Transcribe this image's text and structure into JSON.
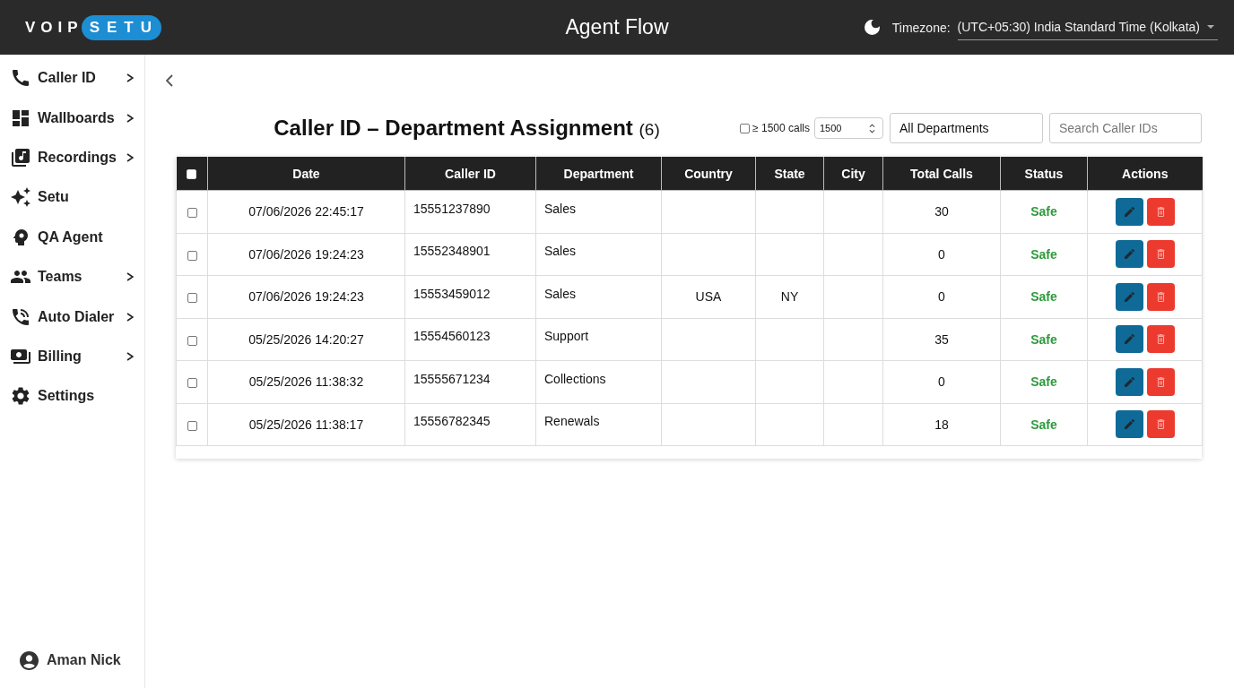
{
  "header": {
    "logo": {
      "plain": "VOIP",
      "highlighted": "SETU"
    },
    "title": "Agent Flow",
    "timezone": {
      "label": "Timezone:",
      "value": "(UTC+05:30) India Standard Time (Kolkata)"
    }
  },
  "sidebar": {
    "items": [
      {
        "label": "Caller ID",
        "has_submenu": true
      },
      {
        "label": "Wallboards",
        "has_submenu": true
      },
      {
        "label": "Recordings",
        "has_submenu": true
      },
      {
        "label": "Setu",
        "has_submenu": false
      },
      {
        "label": "QA Agent",
        "has_submenu": false
      },
      {
        "label": "Teams",
        "has_submenu": true
      },
      {
        "label": "Auto Dialer",
        "has_submenu": true
      },
      {
        "label": "Billing",
        "has_submenu": true
      },
      {
        "label": "Settings",
        "has_submenu": false
      }
    ],
    "user": {
      "name": "Aman Nick"
    }
  },
  "page": {
    "title": "Caller ID – Department Assignment",
    "count": "(6)",
    "filters": {
      "min_calls": {
        "checked": false,
        "label": "≥ 1500 calls",
        "value": "1500"
      },
      "department": {
        "value": "All Departments"
      },
      "search": {
        "placeholder": "Search Caller IDs"
      }
    }
  },
  "table": {
    "select_all": {
      "checked": false
    },
    "columns": [
      "Date",
      "Caller ID",
      "Department",
      "Country",
      "State",
      "City",
      "Total Calls",
      "Status",
      "Actions"
    ],
    "rows": [
      {
        "selected": false,
        "date": "07/06/2026 22:45:17",
        "caller_id": "15551237890",
        "department": "Sales",
        "total_calls": "30",
        "status": "Safe"
      },
      {
        "selected": false,
        "date": "07/06/2026 19:24:23",
        "caller_id": "15552348901",
        "department": "Sales",
        "total_calls": "0",
        "status": "Safe"
      },
      {
        "selected": false,
        "date": "07/06/2026 19:24:23",
        "caller_id": "15553459012",
        "department": "Sales",
        "country": "USA",
        "state": "NY",
        "total_calls": "0",
        "status": "Safe"
      },
      {
        "selected": false,
        "date": "05/25/2026 14:20:27",
        "caller_id": "15554560123",
        "department": "Support",
        "total_calls": "35",
        "status": "Safe"
      },
      {
        "selected": false,
        "date": "05/25/2026 11:38:32",
        "caller_id": "15555671234",
        "department": "Collections",
        "total_calls": "0",
        "status": "Safe"
      },
      {
        "selected": false,
        "date": "05/25/2026 11:38:17",
        "caller_id": "15556782345",
        "department": "Renewals",
        "total_calls": "18",
        "status": "Safe"
      }
    ]
  }
}
